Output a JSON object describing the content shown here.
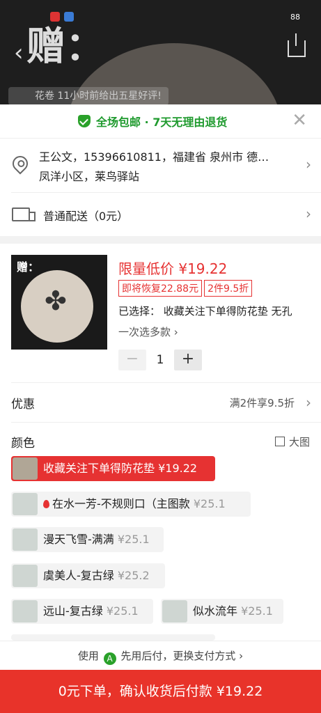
{
  "status": {
    "battery": "88"
  },
  "background": {
    "bigchar": "赠：",
    "review": "花卷 11小时前给出五星好评!"
  },
  "banner": {
    "text": "全场包邮 · 7天无理由退货",
    "close": "✕"
  },
  "address": {
    "line1": "王公文，15396610811，福建省 泉州市 德…",
    "line2": "凤洋小区，莱鸟驿站"
  },
  "shipping": {
    "label": "普通配送（0元）"
  },
  "product": {
    "thumb_tag": "赠：",
    "price": "限量低价 ¥19.22",
    "tag1": "即将恢复22.88元",
    "tag2": "2件9.5折",
    "selected": "已选择： 收藏关注下单得防花垫 无孔",
    "multi": "一次选多款 ›",
    "minus": "−",
    "qty": "1",
    "plus": "+"
  },
  "discount": {
    "label": "优惠",
    "value": "满2件享9.5折"
  },
  "color": {
    "label": "颜色",
    "big_image": "大图"
  },
  "variants": [
    {
      "name": "收藏关注下单得防花垫",
      "price": "¥19.22"
    },
    {
      "name": "在水一芳-不规则口（主图款",
      "price": "¥25.1"
    },
    {
      "name": "漫天飞雪-满满",
      "price": "¥25.1"
    },
    {
      "name": "虞美人-复古绿",
      "price": "¥25.2"
    },
    {
      "name": "远山-复古绿",
      "price": "¥25.1"
    },
    {
      "name": "似水流年",
      "price": "¥25.1"
    }
  ],
  "pay": {
    "prefix": "使用",
    "logo": "A",
    "text": "先用后付，更换支付方式 ›"
  },
  "cta": {
    "label": "0元下单，确认收货后付款 ¥19.22"
  },
  "colors": {
    "red": "#e63232",
    "green": "#1f9a2e"
  }
}
